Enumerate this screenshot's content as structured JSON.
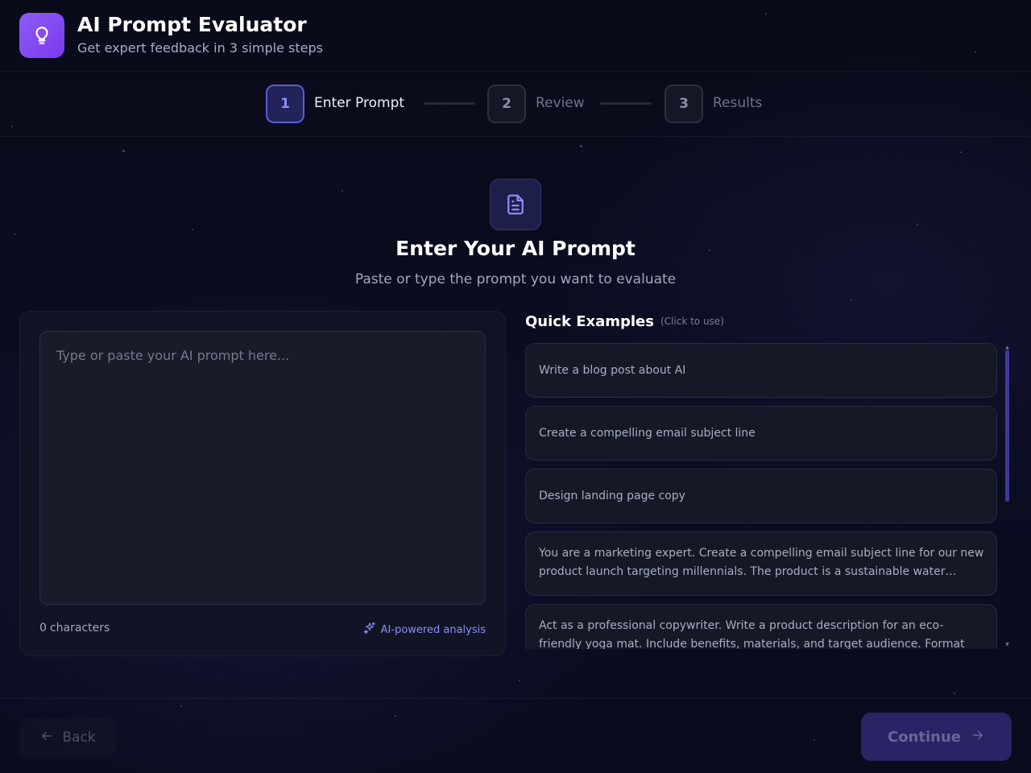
{
  "header": {
    "title": "AI Prompt Evaluator",
    "subtitle": "Get expert feedback in 3 simple steps",
    "logo_icon": "lightbulb-icon",
    "accent": "#8b5cf6"
  },
  "stepper": {
    "steps": [
      {
        "number": "1",
        "label": "Enter Prompt",
        "state": "active"
      },
      {
        "number": "2",
        "label": "Review",
        "state": "inactive"
      },
      {
        "number": "3",
        "label": "Results",
        "state": "inactive"
      }
    ]
  },
  "hero": {
    "icon": "document-icon",
    "title": "Enter Your AI Prompt",
    "subtitle": "Paste or type the prompt you want to evaluate"
  },
  "prompt": {
    "value": "",
    "placeholder": "Type or paste your AI prompt here...",
    "char_count": "0",
    "char_unit": "characters",
    "ai_badge": "AI-powered analysis",
    "ai_icon": "sparkles-icon"
  },
  "examples": {
    "title": "Quick Examples",
    "hint": "(Click to use)",
    "items": [
      {
        "text": "Write a blog post about AI"
      },
      {
        "text": "Create a compelling email subject line"
      },
      {
        "text": "Design landing page copy"
      },
      {
        "text": "You are a marketing expert. Create a compelling email subject line for our new product launch targeting millennials. The product is a sustainable water…"
      },
      {
        "text": "Act as a professional copywriter. Write a product description for an eco-friendly yoga mat. Include benefits, materials, and target audience. Format …"
      }
    ]
  },
  "footer": {
    "back_label": "Back",
    "continue_label": "Continue",
    "continue_color": "#2a2366"
  }
}
